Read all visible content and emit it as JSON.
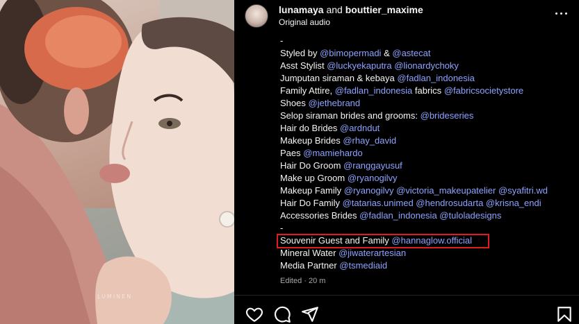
{
  "post": {
    "header": {
      "user1": "lunamaya",
      "conjunction": "and",
      "user2": "bouttier_maxime",
      "audio": "Original audio"
    },
    "photo": {
      "watermark": "LUMINEN"
    },
    "caption": {
      "lines": [
        {
          "text": "-",
          "tags": ""
        },
        {
          "text": "Styled by",
          "tags": "@bimopermadi",
          "text2": "&",
          "tags2": "@astecat"
        },
        {
          "text": "Asst Stylist",
          "tags": "@luckyekaputra @lionardychoky"
        },
        {
          "text": "Jumputan siraman & kebaya",
          "tags": "@fadlan_indonesia"
        },
        {
          "text": "Family Attire,",
          "tags": "@fadlan_indonesia",
          "text2": "fabrics",
          "tags2": "@fabricsocietystore"
        },
        {
          "text": "Shoes",
          "tags": "@jethebrand"
        },
        {
          "text": "Selop siraman brides and grooms:",
          "tags": "@brideseries"
        },
        {
          "text": "Hair do Brides",
          "tags": "@ardndut"
        },
        {
          "text": "Makeup Brides",
          "tags": "@rhay_david"
        },
        {
          "text": "Paes",
          "tags": "@mamiehardo"
        },
        {
          "text": "Hair Do Groom",
          "tags": "@ranggayusuf"
        },
        {
          "text": "Make up Groom",
          "tags": "@ryanogilvy"
        },
        {
          "text": "Makeup Family",
          "tags": "@ryanogilvy @victoria_makeupatelier @syafitri.wd"
        },
        {
          "text": "Hair Do Family",
          "tags": "@tatarias.unimed @hendrosudarta @krisna_endi"
        },
        {
          "text": "Accessories Brides",
          "tags": "@fadlan_indonesia @tuloladesigns"
        },
        {
          "text": "-",
          "tags": ""
        },
        {
          "text": "Souvenir Guest and Family",
          "tags": "@hannaglow.official"
        },
        {
          "text": "Mineral Water",
          "tags": "@jiwaterartesian"
        },
        {
          "text": "Media Partner",
          "tags": "@tsmediaid"
        }
      ],
      "edited": "Edited · 20 m"
    },
    "actions": {
      "like_icon": "heart-icon",
      "comment_icon": "comment-icon",
      "share_icon": "send-icon",
      "save_icon": "bookmark-icon",
      "more_icon": "more-horizontal-icon"
    },
    "colors": {
      "mention": "#8ea3ff",
      "highlight_border": "#e01b24",
      "background": "#000000"
    }
  }
}
